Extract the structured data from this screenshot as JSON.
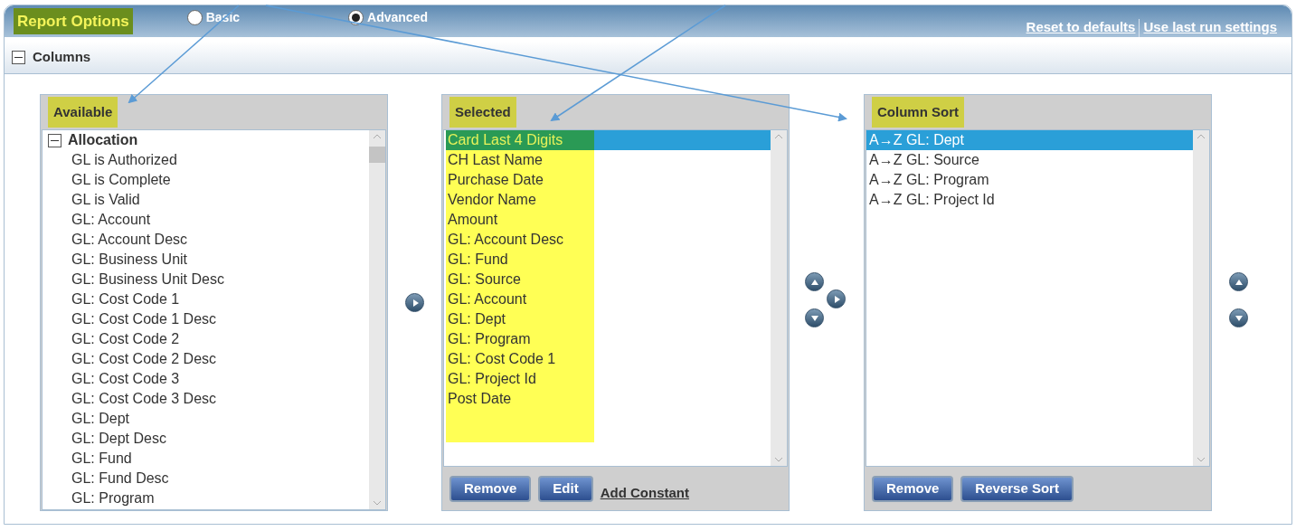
{
  "header": {
    "title": "Report Options",
    "title_highlighted": true,
    "radios": [
      {
        "label": "Basic",
        "selected": false
      },
      {
        "label": "Advanced",
        "selected": true
      }
    ],
    "links": [
      "Reset to defaults",
      "Use last run settings"
    ]
  },
  "section": {
    "title": "Columns",
    "expanded": true
  },
  "available": {
    "title": "Available",
    "title_highlighted": true,
    "groups": [
      {
        "label": "Allocation",
        "expanded": true,
        "children": [
          "GL is Authorized",
          "GL is Complete",
          "GL is Valid",
          "GL: Account",
          "GL: Account Desc",
          "GL: Business Unit",
          "GL: Business Unit Desc",
          "GL: Cost Code 1",
          "GL: Cost Code 1 Desc",
          "GL: Cost Code 2",
          "GL: Cost Code 2 Desc",
          "GL: Cost Code 3",
          "GL: Cost Code 3 Desc",
          "GL: Dept",
          "GL: Dept Desc",
          "GL: Fund",
          "GL: Fund Desc",
          "GL: Program"
        ]
      }
    ]
  },
  "selected": {
    "title": "Selected",
    "title_highlighted": true,
    "items": [
      {
        "label": "Card Last 4 Digits",
        "selected": true,
        "highlighted": true
      },
      {
        "label": "CH Last Name",
        "selected": false,
        "highlighted": true
      },
      {
        "label": "Purchase Date",
        "selected": false,
        "highlighted": true
      },
      {
        "label": "Vendor Name",
        "selected": false,
        "highlighted": true
      },
      {
        "label": "Amount",
        "selected": false,
        "highlighted": true
      },
      {
        "label": "GL: Account Desc",
        "selected": false,
        "highlighted": true
      },
      {
        "label": "GL: Fund",
        "selected": false,
        "highlighted": true
      },
      {
        "label": "GL: Source",
        "selected": false,
        "highlighted": true
      },
      {
        "label": "GL: Account",
        "selected": false,
        "highlighted": true
      },
      {
        "label": "GL: Dept",
        "selected": false,
        "highlighted": true
      },
      {
        "label": "GL: Program",
        "selected": false,
        "highlighted": true
      },
      {
        "label": "GL: Cost Code 1",
        "selected": false,
        "highlighted": true
      },
      {
        "label": "GL: Project Id",
        "selected": false,
        "highlighted": true
      },
      {
        "label": "Post Date",
        "selected": false,
        "highlighted": true
      }
    ],
    "buttons": [
      "Remove",
      "Edit"
    ],
    "link": "Add Constant"
  },
  "sort": {
    "title": "Column Sort",
    "title_highlighted": true,
    "items": [
      {
        "label": "A→Z GL: Dept",
        "selected": true
      },
      {
        "label": "A→Z GL: Source",
        "selected": false
      },
      {
        "label": "A→Z GL: Program",
        "selected": false
      },
      {
        "label": "A→Z GL: Project Id",
        "selected": false
      }
    ],
    "buttons": [
      "Remove",
      "Reverse Sort"
    ]
  }
}
